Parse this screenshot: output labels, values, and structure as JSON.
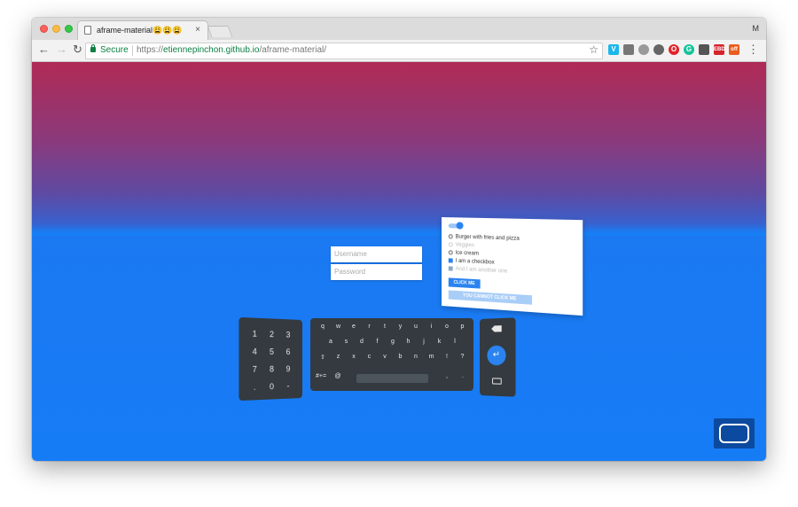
{
  "browser": {
    "tab_title": "aframe-material😩😩😩",
    "tab_close": "×",
    "profile_initial": "M",
    "secure_label": "Secure",
    "url_scheme": "https://",
    "url_host": "etiennepinchon.github.io",
    "url_path": "/aframe-material/",
    "nav": {
      "back": "←",
      "forward": "→",
      "reload": "↻"
    },
    "bookmark_star": "☆",
    "menu": "⋮",
    "extensions": [
      "vimeo-icon",
      "cast-icon",
      "cloud-icon",
      "settings-extension-icon",
      "opera-icon",
      "grammarly-icon",
      "extension-badge-icon",
      "extension-ebd-icon",
      "extension-gift-icon"
    ],
    "ext_labels": {
      "vimeo": "V",
      "grammarly": "G",
      "opera": "O",
      "ebd": "EBD",
      "off": "off"
    }
  },
  "scene": {
    "username_placeholder": "Username",
    "password_placeholder": "Password",
    "panel": {
      "options": [
        {
          "label": "Burger with fries and pizza",
          "type": "radio",
          "state": "off"
        },
        {
          "label": "Veggies",
          "type": "radio",
          "state": "disabled"
        },
        {
          "label": "Ice cream",
          "type": "radio",
          "state": "off"
        },
        {
          "label": "I am a checkbox",
          "type": "checkbox",
          "state": "on"
        },
        {
          "label": "And I am another one",
          "type": "checkbox",
          "state": "disabled"
        }
      ],
      "click_button": "CLICK ME",
      "disabled_button": "YOU CANNOT CLICK ME"
    },
    "numpad": {
      "rows": [
        [
          "1",
          "2",
          "3"
        ],
        [
          "4",
          "5",
          "6"
        ],
        [
          "7",
          "8",
          "9"
        ],
        [
          ".",
          "0",
          "-"
        ]
      ]
    },
    "keyboard": {
      "rows": [
        [
          "q",
          "w",
          "e",
          "r",
          "t",
          "y",
          "u",
          "i",
          "o",
          "p"
        ],
        [
          "a",
          "s",
          "d",
          "f",
          "g",
          "h",
          "j",
          "k",
          "l"
        ],
        [
          "⇧",
          "z",
          "x",
          "c",
          "v",
          "b",
          "n",
          "m",
          "!",
          "?"
        ],
        [
          "#+=",
          "@",
          "",
          ",",
          "."
        ]
      ]
    },
    "sidepad": {
      "enter": "↵"
    },
    "colors": {
      "sky_top": "#b02a55",
      "ground": "#167cf6",
      "accent": "#2a83f0",
      "keyboard": "#343a3f"
    }
  }
}
